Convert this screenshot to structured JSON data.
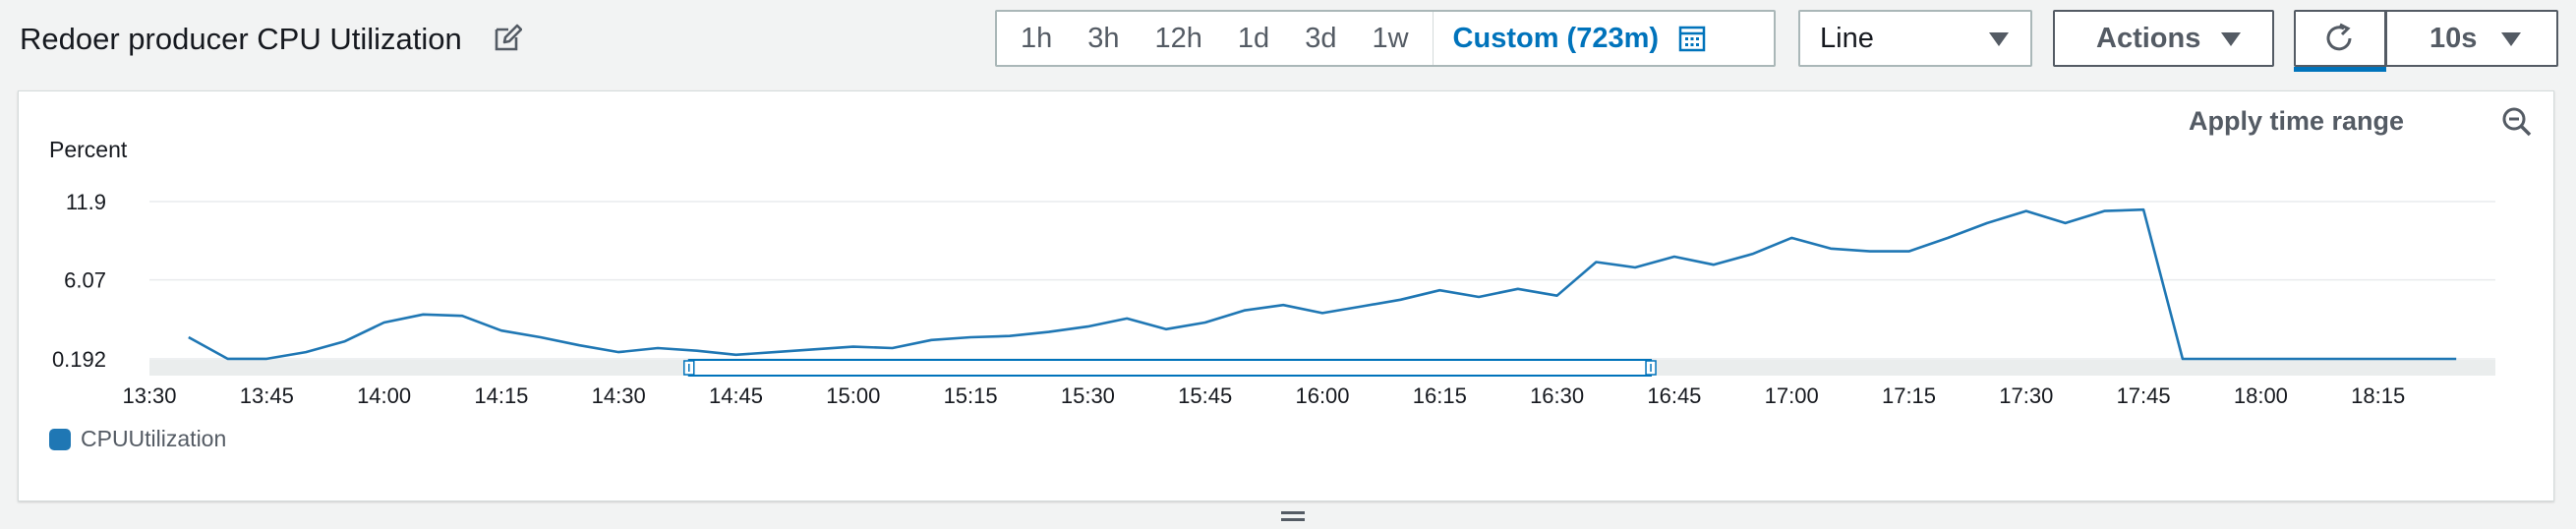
{
  "header": {
    "title": "Redoer producer CPU Utilization",
    "edit_icon": "edit-icon"
  },
  "time_range": {
    "options": [
      "1h",
      "3h",
      "12h",
      "1d",
      "3d",
      "1w"
    ],
    "custom_label": "Custom (723m)",
    "calendar_icon": "calendar-icon"
  },
  "chart_type_select": {
    "value": "Line"
  },
  "actions": {
    "label": "Actions"
  },
  "refresh": {
    "icon": "refresh-icon",
    "interval": "10s"
  },
  "panel": {
    "apply_time_range": "Apply time range",
    "zoom_out_icon": "zoom-out-icon"
  },
  "colors": {
    "series": "#1f77b4",
    "accent": "#0073bb"
  },
  "chart_data": {
    "type": "line",
    "ylabel": "Percent",
    "yticks": [
      "11.9",
      "6.07",
      "0.192"
    ],
    "ylim": [
      0.192,
      11.9
    ],
    "xticks": [
      "13:30",
      "13:45",
      "14:00",
      "14:15",
      "14:30",
      "14:45",
      "15:00",
      "15:15",
      "15:30",
      "15:45",
      "16:00",
      "16:15",
      "16:30",
      "16:45",
      "17:00",
      "17:15",
      "17:30",
      "17:45",
      "18:00",
      "18:15"
    ],
    "grid": true,
    "legend_position": "bottom-left",
    "navigator_window": [
      "14:39",
      "16:42"
    ],
    "series": [
      {
        "name": "CPUUtilization",
        "x": [
          "13:35",
          "13:40",
          "13:45",
          "13:50",
          "13:55",
          "14:00",
          "14:05",
          "14:10",
          "14:15",
          "14:20",
          "14:25",
          "14:30",
          "14:35",
          "14:40",
          "14:45",
          "14:50",
          "14:55",
          "15:00",
          "15:05",
          "15:10",
          "15:15",
          "15:20",
          "15:25",
          "15:30",
          "15:35",
          "15:40",
          "15:45",
          "15:50",
          "15:55",
          "16:00",
          "16:05",
          "16:10",
          "16:15",
          "16:20",
          "16:25",
          "16:30",
          "16:35",
          "16:40",
          "16:45",
          "16:50",
          "16:55",
          "17:00",
          "17:05",
          "17:10",
          "17:15",
          "17:20",
          "17:25",
          "17:30",
          "17:35",
          "17:40",
          "17:45",
          "17:50",
          "17:55",
          "18:00",
          "18:05",
          "18:10",
          "18:15",
          "18:20",
          "18:25"
        ],
        "values": [
          1.8,
          0.2,
          0.2,
          0.7,
          1.5,
          2.9,
          3.5,
          3.4,
          2.3,
          1.8,
          1.2,
          0.7,
          1.0,
          0.8,
          0.5,
          0.7,
          0.9,
          1.1,
          1.0,
          1.6,
          1.8,
          1.9,
          2.2,
          2.6,
          3.2,
          2.4,
          2.9,
          3.8,
          4.2,
          3.6,
          4.1,
          4.6,
          5.3,
          4.8,
          5.4,
          4.9,
          7.4,
          7.0,
          7.8,
          7.2,
          8.0,
          9.2,
          8.4,
          8.2,
          8.2,
          9.2,
          10.3,
          11.2,
          10.3,
          11.2,
          11.3,
          0.192,
          0.192,
          0.192,
          0.192,
          0.192,
          0.192,
          0.192,
          0.192
        ]
      }
    ]
  }
}
